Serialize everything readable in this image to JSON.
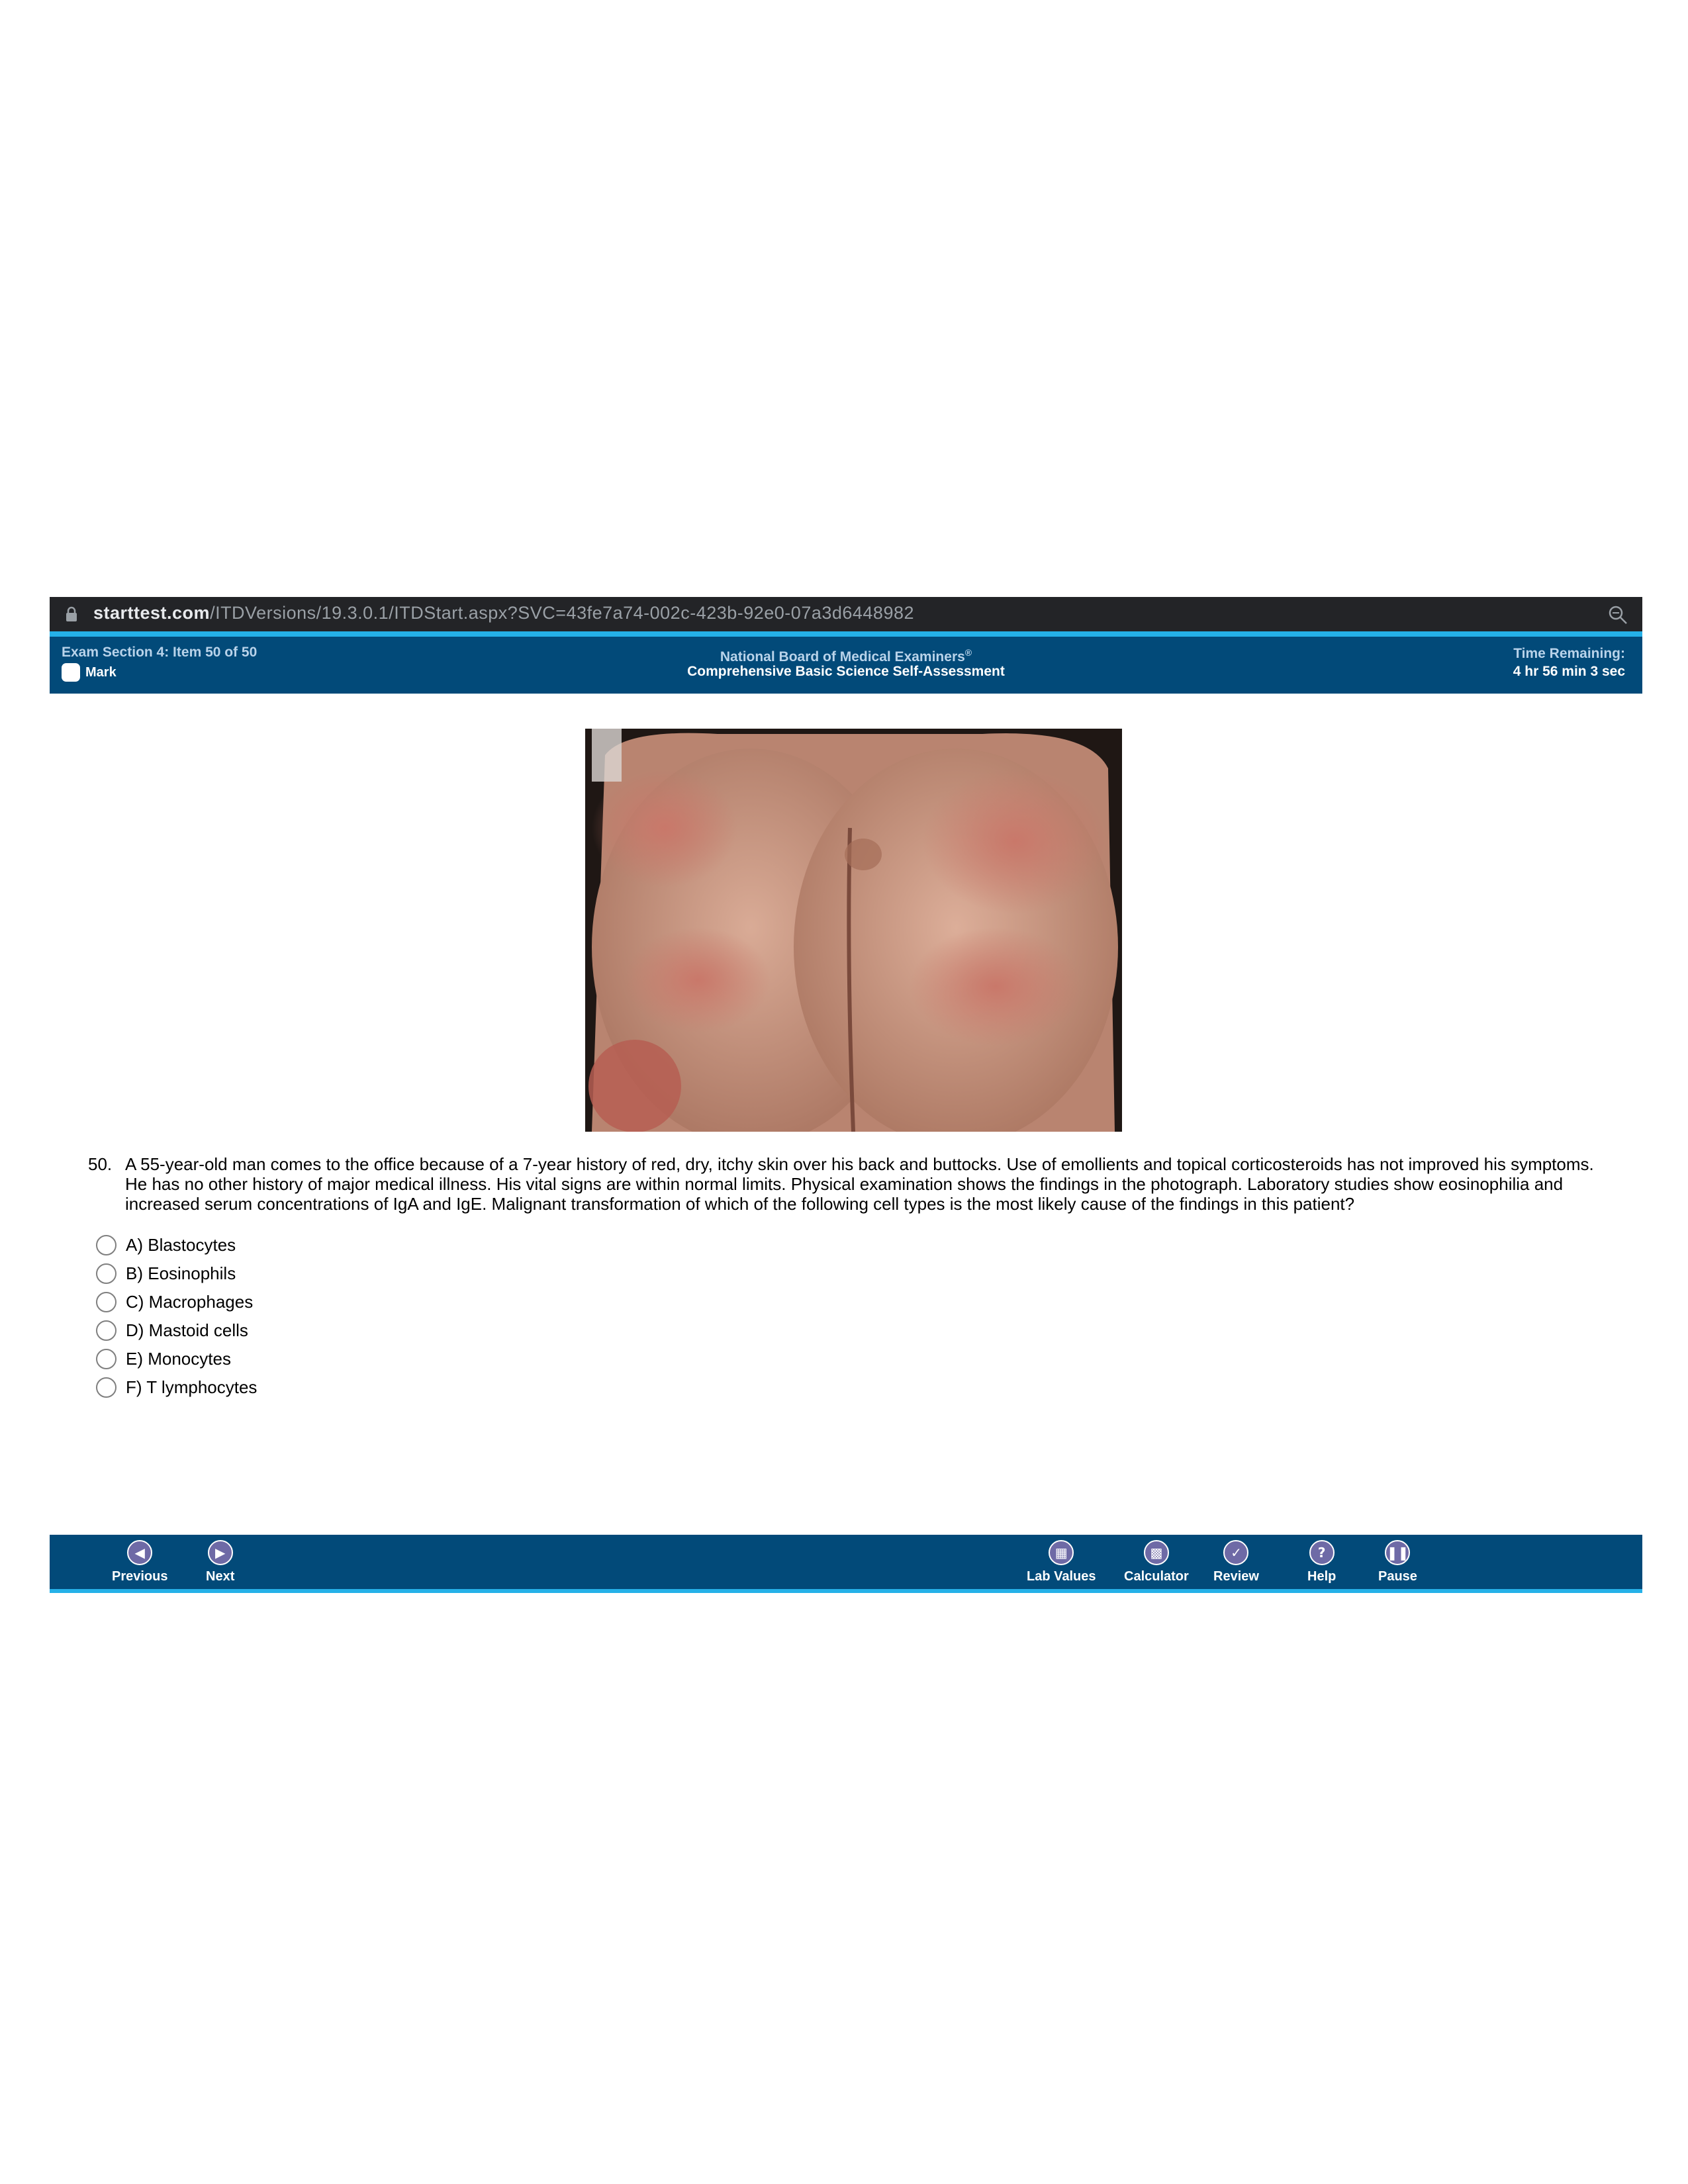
{
  "browser": {
    "url_host": "starttest.com",
    "url_path": "/ITDVersions/19.3.0.1/ITDStart.aspx?SVC=43fe7a74-002c-423b-92e0-07a3d6448982"
  },
  "header": {
    "section": "Exam Section 4: Item 50 of 50",
    "mark_label": "Mark",
    "organization": "National Board of Medical Examiners",
    "registered": "®",
    "exam_name": "Comprehensive Basic Science Self-Assessment",
    "time_label": "Time Remaining:",
    "time_value": "4 hr 56 min 3 sec"
  },
  "question": {
    "number": "50.",
    "text": "A 55-year-old man comes to the office because of a 7-year history of red, dry, itchy skin over his back and buttocks. Use of emollients and topical corticosteroids has not improved his symptoms. He has no other history of major medical illness. His vital signs are within normal limits. Physical examination shows the findings in the photograph. Laboratory studies show eosinophilia and increased serum concentrations of IgA and IgE. Malignant transformation of which of the following cell types is the most likely cause of the findings in this patient?",
    "options": [
      "A) Blastocytes",
      "B) Eosinophils",
      "C) Macrophages",
      "D) Mastoid cells",
      "E) Monocytes",
      "F) T lymphocytes"
    ]
  },
  "footer": {
    "previous": "Previous",
    "next": "Next",
    "lab_values": "Lab Values",
    "calculator": "Calculator",
    "review": "Review",
    "help": "Help",
    "pause": "Pause"
  },
  "colors": {
    "header_bg": "#024a79",
    "accent_strip": "#25b1e8",
    "icon_purple": "#6e6aa6",
    "urlbar_bg": "#232427"
  }
}
